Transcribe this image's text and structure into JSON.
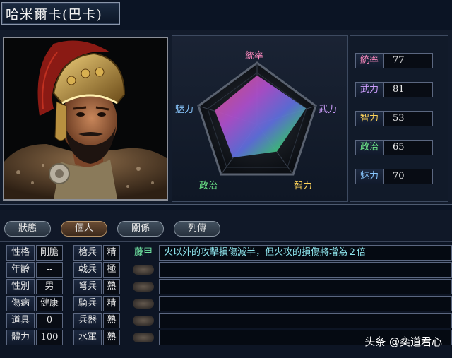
{
  "title": "哈米爾卡(巴卡)",
  "portrait": {
    "description_icon": "warrior-portrait"
  },
  "radar": {
    "labels": {
      "top": "統率",
      "right": "武力",
      "bottom_right": "智力",
      "bottom_left": "政治",
      "left": "魅力"
    },
    "label_colors": {
      "top": "#ff8ac0",
      "right": "#d0a0ff",
      "bottom_right": "#ffd45a",
      "bottom_left": "#6eea8a",
      "left": "#8ac8ff"
    }
  },
  "stats": [
    {
      "label": "統率",
      "value": "77",
      "color": "#ff8ac0"
    },
    {
      "label": "武力",
      "value": "81",
      "color": "#d0a0ff"
    },
    {
      "label": "智力",
      "value": "53",
      "color": "#ffd45a"
    },
    {
      "label": "政治",
      "value": "65",
      "color": "#6eea8a"
    },
    {
      "label": "魅力",
      "value": "70",
      "color": "#8ac8ff"
    }
  ],
  "tabs": [
    {
      "label": "狀態",
      "active": false
    },
    {
      "label": "個人",
      "active": true
    },
    {
      "label": "關係",
      "active": false
    },
    {
      "label": "列傳",
      "active": false
    }
  ],
  "info": [
    {
      "label": "性格",
      "value": "剛膽"
    },
    {
      "label": "年齡",
      "value": "--"
    },
    {
      "label": "性別",
      "value": "男"
    },
    {
      "label": "傷病",
      "value": "健康"
    },
    {
      "label": "道具",
      "value": "0"
    },
    {
      "label": "體力",
      "value": "100"
    }
  ],
  "aptitudes": [
    {
      "label": "槍兵",
      "value": "精"
    },
    {
      "label": "戟兵",
      "value": "極"
    },
    {
      "label": "弩兵",
      "value": "熟"
    },
    {
      "label": "騎兵",
      "value": "精"
    },
    {
      "label": "兵器",
      "value": "熟"
    },
    {
      "label": "水軍",
      "value": "熟"
    }
  ],
  "skills": [
    {
      "name": "藤甲",
      "description": "火以外的攻擊損傷減半，但火攻的損傷將增為２倍"
    },
    {
      "name": "",
      "description": ""
    },
    {
      "name": "",
      "description": ""
    },
    {
      "name": "",
      "description": ""
    },
    {
      "name": "",
      "description": ""
    },
    {
      "name": "",
      "description": ""
    }
  ],
  "watermark": "头条 @奕道君心"
}
